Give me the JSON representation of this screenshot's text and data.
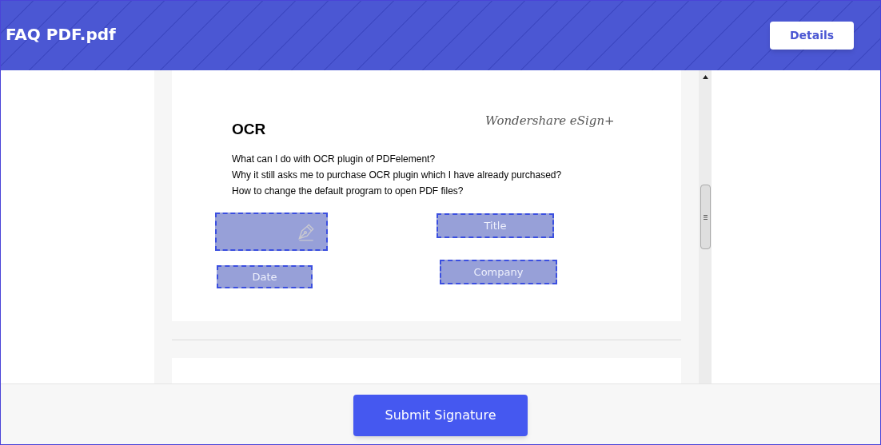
{
  "header": {
    "title": "FAQ PDF.pdf",
    "button": "Details"
  },
  "page": {
    "stamp": "Wondershare eSign+",
    "heading": "OCR",
    "questions": [
      "What can I do with OCR plugin of PDFelement?",
      "Why it still asks me to purchase OCR plugin which I have already purchased?",
      "How to change the default program to open PDF files?"
    ],
    "fields": [
      {
        "kind": "signature"
      },
      {
        "kind": "text",
        "label": "Title"
      },
      {
        "kind": "text",
        "label": "Date"
      },
      {
        "kind": "text",
        "label": "Company"
      }
    ]
  },
  "footer": {
    "button": "Submit Signature"
  }
}
